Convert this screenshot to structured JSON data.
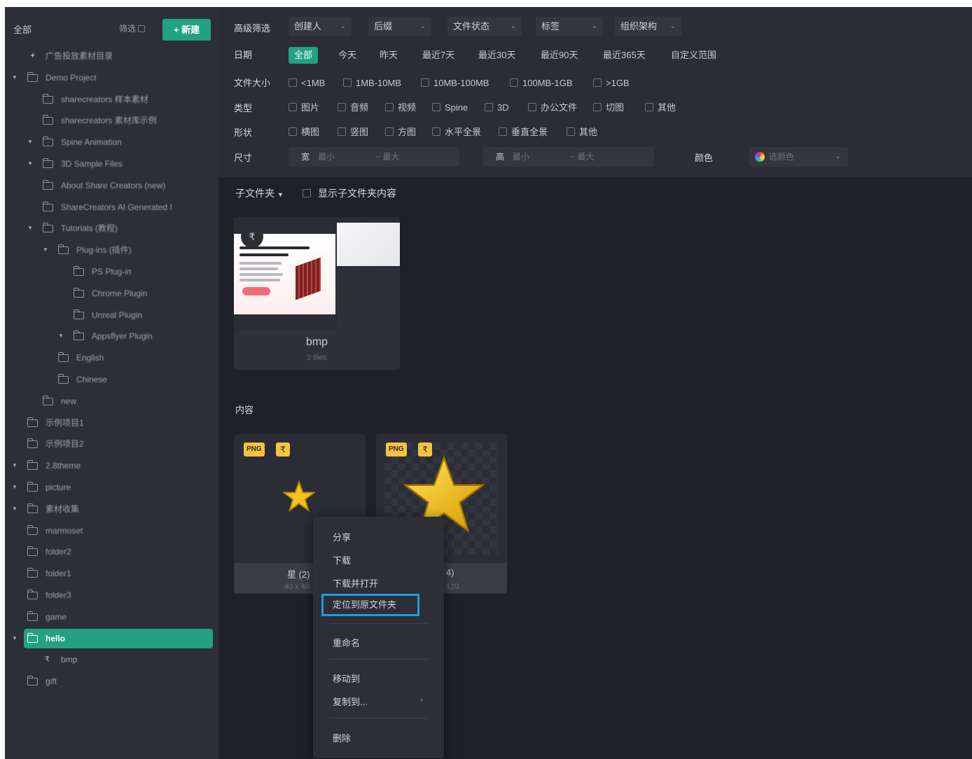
{
  "sidebar": {
    "title": "全部",
    "sort_label": "筛选",
    "new_button": "+ 新建",
    "items": [
      {
        "label": "广告投放素材目录",
        "level": 0,
        "kind": "pin"
      },
      {
        "label": "Demo Project",
        "level": 0,
        "kind": "folder",
        "arrow": true
      },
      {
        "label": "sharecreators 样本素材",
        "level": 1,
        "kind": "folder"
      },
      {
        "label": "sharecreators 素材库示例",
        "level": 1,
        "kind": "folder"
      },
      {
        "label": "Spine Animation",
        "level": 1,
        "kind": "folder",
        "arrow": true
      },
      {
        "label": "3D Sample Files",
        "level": 1,
        "kind": "folder",
        "arrow": true
      },
      {
        "label": "About Share Creators (new)",
        "level": 1,
        "kind": "folder"
      },
      {
        "label": "ShareCreators AI Generated I",
        "level": 1,
        "kind": "folder"
      },
      {
        "label": "Tutorials (教程)",
        "level": 1,
        "kind": "folder",
        "arrow": true
      },
      {
        "label": "Plug-ins (插件)",
        "level": 2,
        "kind": "folder",
        "arrow": true
      },
      {
        "label": "PS Plug-in",
        "level": 3,
        "kind": "folder"
      },
      {
        "label": "Chrome Plugin",
        "level": 3,
        "kind": "folder"
      },
      {
        "label": "Unreal Plugin",
        "level": 3,
        "kind": "folder"
      },
      {
        "label": "Appsflyer Plugin",
        "level": 3,
        "kind": "folder",
        "arrow": true
      },
      {
        "label": "English",
        "level": 2,
        "kind": "folder"
      },
      {
        "label": "Chinese",
        "level": 2,
        "kind": "folder"
      },
      {
        "label": "new",
        "level": 1,
        "kind": "folder"
      },
      {
        "label": "示例项目1",
        "level": 0,
        "kind": "folder"
      },
      {
        "label": "示例项目2",
        "level": 0,
        "kind": "folder"
      },
      {
        "label": "2.8theme",
        "level": 0,
        "kind": "folder",
        "arrow": true
      },
      {
        "label": "picture",
        "level": 0,
        "kind": "folder",
        "arrow": true
      },
      {
        "label": "素材收集",
        "level": 0,
        "kind": "folder",
        "arrow": true
      },
      {
        "label": "marmoset",
        "level": 0,
        "kind": "folder"
      },
      {
        "label": "folder2",
        "level": 0,
        "kind": "folder"
      },
      {
        "label": "folder1",
        "level": 0,
        "kind": "folder"
      },
      {
        "label": "folder3",
        "level": 0,
        "kind": "folder"
      },
      {
        "label": "game",
        "level": 0,
        "kind": "folder"
      },
      {
        "label": "hello",
        "level": 0,
        "kind": "folder",
        "arrow": true,
        "selected": true
      },
      {
        "label": "bmp",
        "level": 1,
        "kind": "link"
      },
      {
        "label": "gift",
        "level": 0,
        "kind": "folder"
      }
    ]
  },
  "filters": {
    "advanced_label": "高级筛选",
    "dropdowns": [
      "创建人",
      "后缀",
      "文件状态",
      "标签",
      "组织架构"
    ],
    "date_label": "日期",
    "date_chips": [
      "全部",
      "今天",
      "昨天",
      "最近7天",
      "最近30天",
      "最近90天",
      "最近365天",
      "自定义范围"
    ],
    "size_label": "文件大小",
    "size_options": [
      "<1MB",
      "1MB-10MB",
      "10MB-100MB",
      "100MB-1GB",
      ">1GB"
    ],
    "type_label": "类型",
    "type_options": [
      "图片",
      "音频",
      "视频",
      "Spine",
      "3D",
      "办公文件",
      "切图",
      "其他"
    ],
    "shape_label": "形状",
    "shape_options": [
      "横图",
      "竖图",
      "方图",
      "水平全景",
      "垂直全景",
      "其他"
    ],
    "dim_label": "尺寸",
    "width_prefix": "宽",
    "height_prefix": "高",
    "min_placeholder": "最小",
    "max_placeholder": "~ 最大",
    "color_label": "颜色",
    "color_placeholder": "选颜色"
  },
  "main": {
    "subfolder_label": "子文件夹",
    "show_sub_label": "显示子文件夹内容",
    "folder_card": {
      "name": "bmp",
      "count": "2 files",
      "badge": "₹"
    },
    "content_label": "内容",
    "assets": [
      {
        "type": "PNG",
        "link": "₹",
        "name": "星 (2)",
        "sub": "40 x 40"
      },
      {
        "type": "PNG",
        "link": "₹",
        "name": "4)",
        "sub": "120"
      }
    ]
  },
  "context_menu": {
    "items": [
      "分享",
      "下载",
      "下载并打开",
      "定位到原文件夹",
      "重命名",
      "移动到",
      "复制到...",
      "删除"
    ],
    "highlighted": "定位到原文件夹"
  }
}
